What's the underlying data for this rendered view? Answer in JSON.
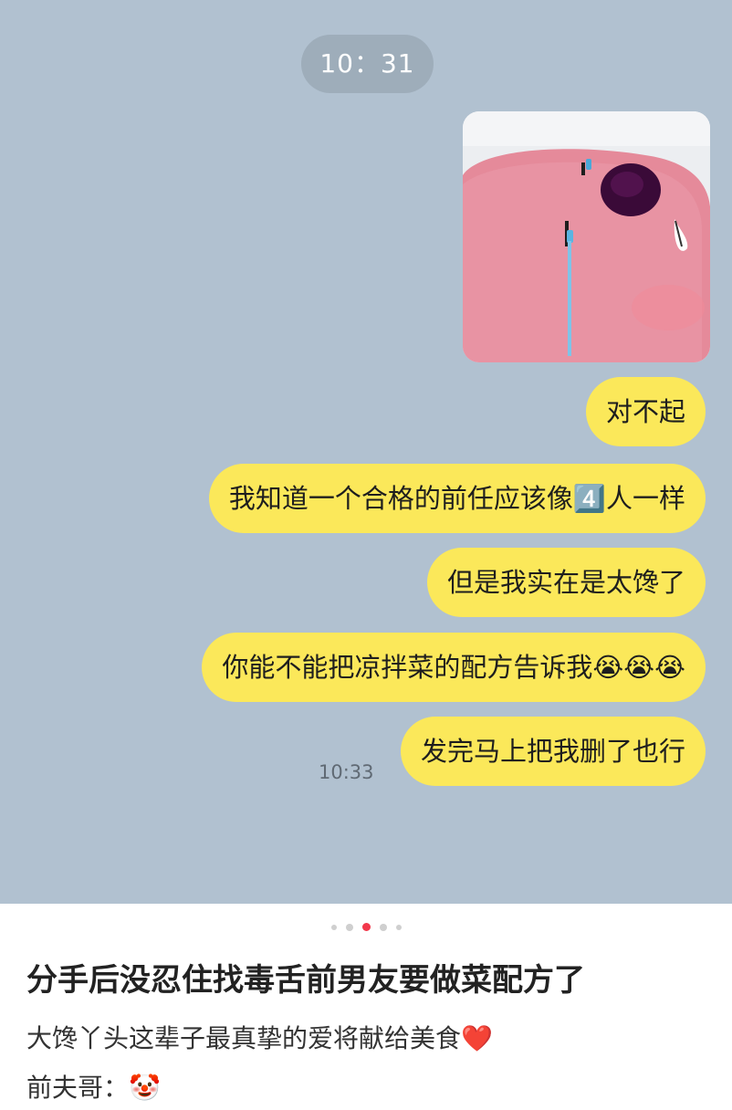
{
  "chat": {
    "header_time": "10：31",
    "messages": [
      {
        "text": "对不起"
      },
      {
        "text": "我知道一个合格的前任应该像4️⃣人一样"
      },
      {
        "text": "但是我实在是太馋了"
      },
      {
        "text": "你能不能把凉拌菜的配方告诉我😭😭😭"
      },
      {
        "text": "发完马上把我删了也行"
      }
    ],
    "last_sent_time": "10:33",
    "image_sticker": "crying-pink-blob-sticker"
  },
  "post": {
    "title": "分手后没忍住找毒舌前男友要做菜配方了",
    "line1": "大馋丫头这辈子最真挚的爱将献给美食❤️",
    "line2": "前夫哥：🤡",
    "carousel_total": 5,
    "carousel_active": 3
  },
  "colors": {
    "chat_background": "#b1c1d0",
    "bubble": "#fbe85a",
    "active_dot": "#f2384b"
  }
}
